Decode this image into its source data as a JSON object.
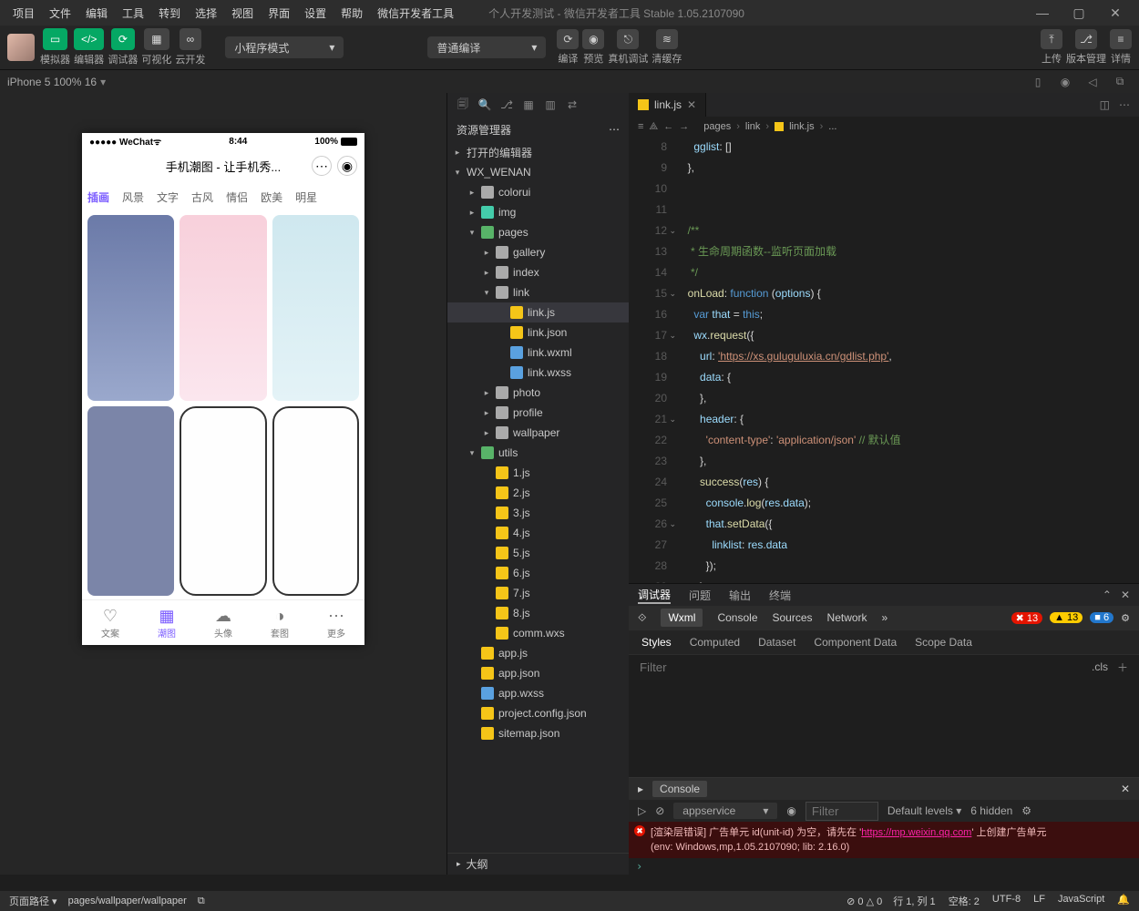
{
  "menu": [
    "项目",
    "文件",
    "编辑",
    "工具",
    "转到",
    "选择",
    "视图",
    "界面",
    "设置",
    "帮助",
    "微信开发者工具"
  ],
  "title": "个人开发测试 - 微信开发者工具 Stable 1.05.2107090",
  "toolbar": {
    "cols": [
      "模拟器",
      "编辑器",
      "调试器",
      "可视化",
      "云开发"
    ],
    "mode_drop": "小程序模式",
    "compile_drop": "普通编译",
    "right_cols": [
      "编译",
      "预览",
      "真机调试",
      "清缓存"
    ],
    "far_cols": [
      "上传",
      "版本管理",
      "详情"
    ]
  },
  "simbar": {
    "device": "iPhone 5 100% 16"
  },
  "phone": {
    "carrier": "●●●●● WeChat",
    "clock": "8:44",
    "batt": "100%",
    "page_title": "手机潮图 - 让手机秀...",
    "tabs": [
      "插画",
      "风景",
      "文字",
      "古风",
      "情侣",
      "欧美",
      "明星"
    ],
    "nav": [
      "文案",
      "潮图",
      "头像",
      "套图",
      "更多"
    ],
    "nav_active": 1
  },
  "explorer": {
    "title": "资源管理器",
    "sections": {
      "opened": "打开的编辑器",
      "project": "WX_WENAN"
    },
    "tree": [
      {
        "t": "colorui",
        "d": 1,
        "i": "fold"
      },
      {
        "t": "img",
        "d": 1,
        "i": "img"
      },
      {
        "t": "pages",
        "d": 1,
        "i": "foldg",
        "open": true
      },
      {
        "t": "gallery",
        "d": 2,
        "i": "fold"
      },
      {
        "t": "index",
        "d": 2,
        "i": "fold"
      },
      {
        "t": "link",
        "d": 2,
        "i": "fold",
        "open": true
      },
      {
        "t": "link.js",
        "d": 3,
        "i": "js",
        "sel": true
      },
      {
        "t": "link.json",
        "d": 3,
        "i": "json"
      },
      {
        "t": "link.wxml",
        "d": 3,
        "i": "wxml"
      },
      {
        "t": "link.wxss",
        "d": 3,
        "i": "wxss"
      },
      {
        "t": "photo",
        "d": 2,
        "i": "fold"
      },
      {
        "t": "profile",
        "d": 2,
        "i": "fold"
      },
      {
        "t": "wallpaper",
        "d": 2,
        "i": "fold"
      },
      {
        "t": "utils",
        "d": 1,
        "i": "foldg",
        "open": true
      },
      {
        "t": "1.js",
        "d": 2,
        "i": "js"
      },
      {
        "t": "2.js",
        "d": 2,
        "i": "js"
      },
      {
        "t": "3.js",
        "d": 2,
        "i": "js"
      },
      {
        "t": "4.js",
        "d": 2,
        "i": "js"
      },
      {
        "t": "5.js",
        "d": 2,
        "i": "js"
      },
      {
        "t": "6.js",
        "d": 2,
        "i": "js"
      },
      {
        "t": "7.js",
        "d": 2,
        "i": "js"
      },
      {
        "t": "8.js",
        "d": 2,
        "i": "js"
      },
      {
        "t": "comm.wxs",
        "d": 2,
        "i": "json"
      },
      {
        "t": "app.js",
        "d": 1,
        "i": "js"
      },
      {
        "t": "app.json",
        "d": 1,
        "i": "json"
      },
      {
        "t": "app.wxss",
        "d": 1,
        "i": "wxss"
      },
      {
        "t": "project.config.json",
        "d": 1,
        "i": "json"
      },
      {
        "t": "sitemap.json",
        "d": 1,
        "i": "json"
      }
    ],
    "outline": "大纲"
  },
  "editor": {
    "tab": "link.js",
    "breadcrumb": [
      "pages",
      "link",
      "link.js",
      "..."
    ],
    "first_line": 8,
    "lines": [
      {
        "html": "    <span class='c-prop'>gglist</span>: []"
      },
      {
        "html": "  },"
      },
      {
        "html": ""
      },
      {
        "html": ""
      },
      {
        "html": "  <span class='c-cmt'>/**</span>"
      },
      {
        "html": "  <span class='c-cmt'> * 生命周期函数--监听页面加载</span>"
      },
      {
        "html": "  <span class='c-cmt'> */</span>"
      },
      {
        "html": "  <span class='c-fn'>onLoad</span>: <span class='c-kw'>function</span> (<span class='c-var'>options</span>) {"
      },
      {
        "html": "    <span class='c-kw'>var</span> <span class='c-var'>that</span> = <span class='c-kw'>this</span>;"
      },
      {
        "html": "    <span class='c-var'>wx</span>.<span class='c-fn'>request</span>({"
      },
      {
        "html": "      <span class='c-prop'>url</span>: <span class='c-url'>'https://xs.guluguluxia.cn/gdlist.php'</span>,"
      },
      {
        "html": "      <span class='c-prop'>data</span>: {"
      },
      {
        "html": "      },"
      },
      {
        "html": "      <span class='c-prop'>header</span>: {"
      },
      {
        "html": "        <span class='c-str'>'content-type'</span>: <span class='c-str'>'application/json'</span> <span class='c-cmt'>// 默认值</span>"
      },
      {
        "html": "      },"
      },
      {
        "html": "      <span class='c-fn'>success</span>(<span class='c-var'>res</span>) {"
      },
      {
        "html": "        <span class='c-var'>console</span>.<span class='c-fn'>log</span>(<span class='c-var'>res</span>.<span class='c-prop'>data</span>);"
      },
      {
        "html": "        <span class='c-var'>that</span>.<span class='c-fn'>setData</span>({"
      },
      {
        "html": "          <span class='c-prop'>linklist</span>: <span class='c-var'>res</span>.<span class='c-prop'>data</span>"
      },
      {
        "html": "        });"
      },
      {
        "html": "      }"
      },
      {
        "html": "    })"
      }
    ],
    "fold_rows": [
      12,
      15,
      17,
      21,
      26
    ]
  },
  "debug": {
    "topbar": [
      "调试器",
      "问题",
      "输出",
      "终端"
    ],
    "devtabs": [
      "Wxml",
      "Console",
      "Sources",
      "Network"
    ],
    "errors": "13",
    "warnings": "13",
    "info": "6",
    "styleTabs": [
      "Styles",
      "Computed",
      "Dataset",
      "Component Data",
      "Scope Data"
    ],
    "filter_ph": "Filter",
    "cls": ".cls",
    "console_label": "Console",
    "scope": "appservice",
    "levels": "Default levels",
    "hidden": "6 hidden",
    "err_msg": "[渲染层错误] 广告单元 id(unit-id) 为空，请先在 '",
    "err_link": "https://mp.weixin.qq.com",
    "err_tail": "' 上创建广告单元",
    "env": "(env: Windows,mp,1.05.2107090; lib: 2.16.0)"
  },
  "status": {
    "left_label": "页面路径",
    "path": "pages/wallpaper/wallpaper",
    "prob": "0",
    "warn": "0",
    "right": [
      "行 1, 列 1",
      "空格: 2",
      "UTF-8",
      "LF",
      "JavaScript"
    ]
  }
}
